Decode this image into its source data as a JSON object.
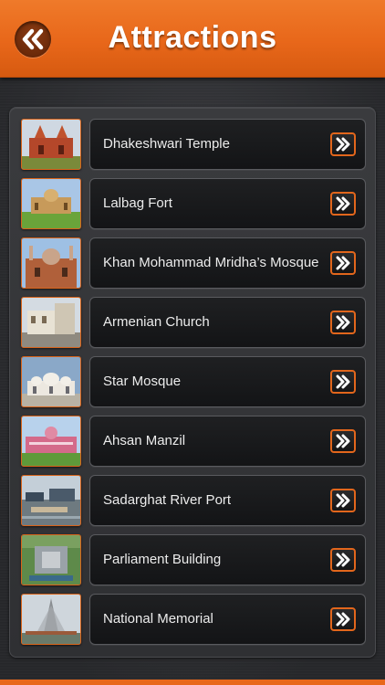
{
  "header": {
    "title": "Attractions",
    "back_icon": "double-chevron-left-icon",
    "accent_color": "#e8671a"
  },
  "attractions": [
    {
      "label": "Dhakeshwari Temple",
      "thumb": "temple"
    },
    {
      "label": "Lalbag Fort",
      "thumb": "fort"
    },
    {
      "label": "Khan Mohammad Mridha’s Mosque",
      "thumb": "mosque-red"
    },
    {
      "label": "Armenian Church",
      "thumb": "church"
    },
    {
      "label": "Star Mosque",
      "thumb": "star-mosque"
    },
    {
      "label": "Ahsan Manzil",
      "thumb": "pink-palace"
    },
    {
      "label": "Sadarghat River Port",
      "thumb": "river-port"
    },
    {
      "label": "Parliament Building",
      "thumb": "parliament"
    },
    {
      "label": "National Memorial",
      "thumb": "memorial"
    }
  ],
  "row_action_icon": "double-chevron-right-icon"
}
